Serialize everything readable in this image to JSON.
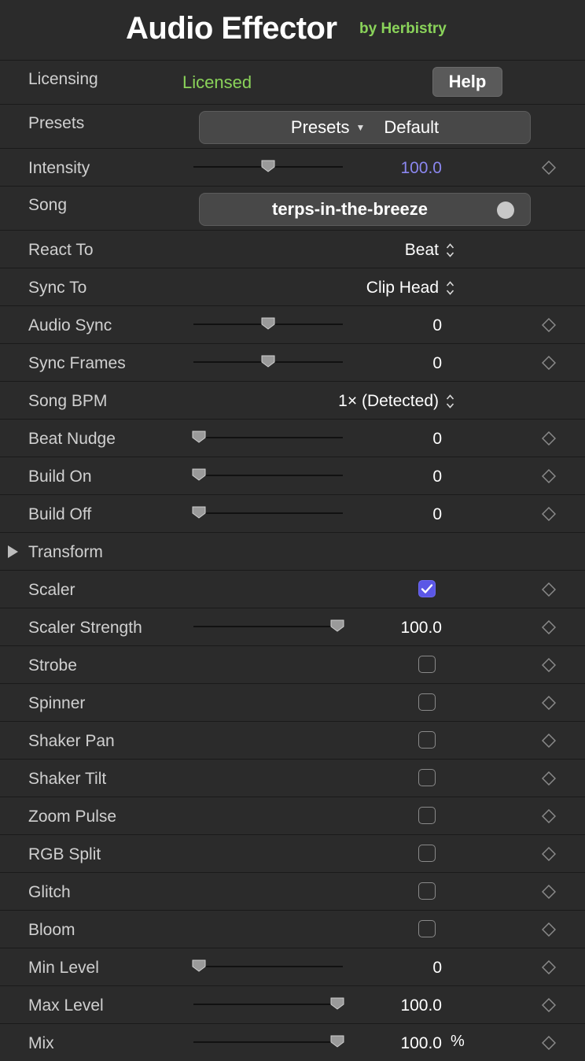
{
  "header": {
    "title": "Audio Effector",
    "byline": "by Herbistry"
  },
  "licensing": {
    "label": "Licensing",
    "status": "Licensed",
    "help_label": "Help"
  },
  "presets": {
    "label": "Presets",
    "button_label": "Presets",
    "selected": "Default"
  },
  "intensity": {
    "label": "Intensity",
    "value": "100.0",
    "slider_position": 0.5
  },
  "song": {
    "label": "Song",
    "value": "terps-in-the-breeze"
  },
  "react_to": {
    "label": "React To",
    "value": "Beat"
  },
  "sync_to": {
    "label": "Sync To",
    "value": "Clip Head"
  },
  "audio_sync": {
    "label": "Audio Sync",
    "value": "0",
    "slider_position": 0.5
  },
  "sync_frames": {
    "label": "Sync Frames",
    "value": "0",
    "slider_position": 0.5
  },
  "song_bpm": {
    "label": "Song BPM",
    "value": "1× (Detected)"
  },
  "beat_nudge": {
    "label": "Beat Nudge",
    "value": "0",
    "slider_position": 0.0
  },
  "build_on": {
    "label": "Build On",
    "value": "0",
    "slider_position": 0.0
  },
  "build_off": {
    "label": "Build Off",
    "value": "0",
    "slider_position": 0.0
  },
  "transform": {
    "label": "Transform"
  },
  "scaler": {
    "label": "Scaler",
    "checked": true
  },
  "scaler_strength": {
    "label": "Scaler Strength",
    "value": "100.0",
    "slider_position": 1.0
  },
  "strobe": {
    "label": "Strobe",
    "checked": false
  },
  "spinner": {
    "label": "Spinner",
    "checked": false
  },
  "shaker_pan": {
    "label": "Shaker Pan",
    "checked": false
  },
  "shaker_tilt": {
    "label": "Shaker Tilt",
    "checked": false
  },
  "zoom_pulse": {
    "label": "Zoom Pulse",
    "checked": false
  },
  "rgb_split": {
    "label": "RGB Split",
    "checked": false
  },
  "glitch": {
    "label": "Glitch",
    "checked": false
  },
  "bloom": {
    "label": "Bloom",
    "checked": false
  },
  "min_level": {
    "label": "Min Level",
    "value": "0",
    "slider_position": 0.0
  },
  "max_level": {
    "label": "Max Level",
    "value": "100.0",
    "slider_position": 1.0
  },
  "mix": {
    "label": "Mix",
    "value": "100.0",
    "unit": "%",
    "slider_position": 1.0
  },
  "colors": {
    "background": "#2b2b2b",
    "accent_green": "#8ad35a",
    "accent_purple": "#8b87f0",
    "checkbox_checked": "#5b57e6"
  },
  "icons": {
    "keyframe": "diamond-icon",
    "popup": "up-down-chevron-icon",
    "disclosure": "triangle-right-icon",
    "preset_caret": "triangle-down-icon"
  }
}
